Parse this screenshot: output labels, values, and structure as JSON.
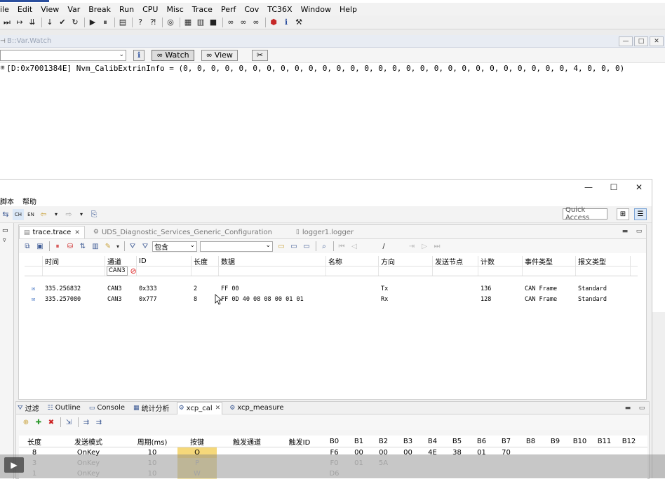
{
  "t32": {
    "menu": [
      "ile",
      "Edit",
      "View",
      "Var",
      "Break",
      "Run",
      "CPU",
      "Misc",
      "Trace",
      "Perf",
      "Cov",
      "TC36X",
      "Window",
      "Help"
    ],
    "watch_title": "B::Var.Watch",
    "watch_btn": "Watch",
    "view_btn": "View",
    "watch_expr": "[D:0x7001384E] Nvm_CalibExtrinInfo = (0, 0, 0, 0, 0, 0, 0, 0, 0, 0, 0, 0, 0, 0, 0, 0, 0, 0, 0, 0, 0, 0, 0, 0, 0, 0, 0, 0, 4, 0, 0, 0)"
  },
  "ecl": {
    "menu": [
      "脚本",
      "帮助"
    ],
    "quick_access": "Quick Access",
    "editor_tabs": [
      {
        "label": "trace.trace",
        "active": true
      },
      {
        "label": "UDS_Diagnostic_Services_Generic_Configuration",
        "active": false
      },
      {
        "label": "logger1.logger",
        "active": false
      }
    ],
    "filter_mode": "包含",
    "trace_columns": [
      "时间",
      "通道",
      "ID",
      "长度",
      "数据",
      "名称",
      "方向",
      "发送节点",
      "计数",
      "事件类型",
      "报文类型"
    ],
    "channel_filter": "CAN3",
    "trace_rows": [
      {
        "time": "335.256832",
        "channel": "CAN3",
        "id": "0x333",
        "len": "2",
        "data": "FF 00",
        "name": "",
        "dir": "Tx",
        "node": "",
        "count": "136",
        "event": "CAN Frame",
        "type": "Standard"
      },
      {
        "time": "335.257080",
        "channel": "CAN3",
        "id": "0x777",
        "len": "8",
        "data": "FF 0D 40 08 08 00 01 01",
        "name": "",
        "dir": "Rx",
        "node": "",
        "count": "128",
        "event": "CAN Frame",
        "type": "Standard"
      }
    ],
    "bottom_tabs": [
      {
        "label": "过滤",
        "active": false
      },
      {
        "label": "Outline",
        "active": false
      },
      {
        "label": "Console",
        "active": false
      },
      {
        "label": "统计分析",
        "active": false
      },
      {
        "label": "xcp_cal",
        "active": true
      },
      {
        "label": "xcp_measure",
        "active": false
      }
    ],
    "xcp_columns": [
      "长度",
      "发送模式",
      "周期(ms)",
      "按键",
      "触发通道",
      "触发ID",
      "B0",
      "B1",
      "B2",
      "B3",
      "B4",
      "B5",
      "B6",
      "B7",
      "B8",
      "B9",
      "B10",
      "B11",
      "B12"
    ],
    "xcp_rows": [
      {
        "len": "8",
        "mode": "OnKey",
        "period": "10",
        "key": "O",
        "trig_ch": "",
        "trig_id": "",
        "bytes": [
          "F6",
          "00",
          "00",
          "00",
          "4E",
          "38",
          "01",
          "70",
          "",
          "",
          "",
          "",
          ""
        ]
      },
      {
        "len": "3",
        "mode": "OnKey",
        "period": "10",
        "key": "P",
        "trig_ch": "",
        "trig_id": "",
        "bytes": [
          "F0",
          "01",
          "5A",
          "",
          "",
          "",
          "",
          "",
          "",
          "",
          "",
          "",
          ""
        ]
      },
      {
        "len": "1",
        "mode": "OnKey",
        "period": "10",
        "key": "W",
        "trig_ch": "",
        "trig_id": "",
        "bytes": [
          "D6",
          "",
          "",
          "",
          "",
          "",
          "",
          "",
          "",
          "",
          "",
          "",
          ""
        ]
      }
    ]
  },
  "colors": {
    "key_highlight": "#f5d87a",
    "accent": "#2b4f9e",
    "stop_red": "#cc2222"
  }
}
